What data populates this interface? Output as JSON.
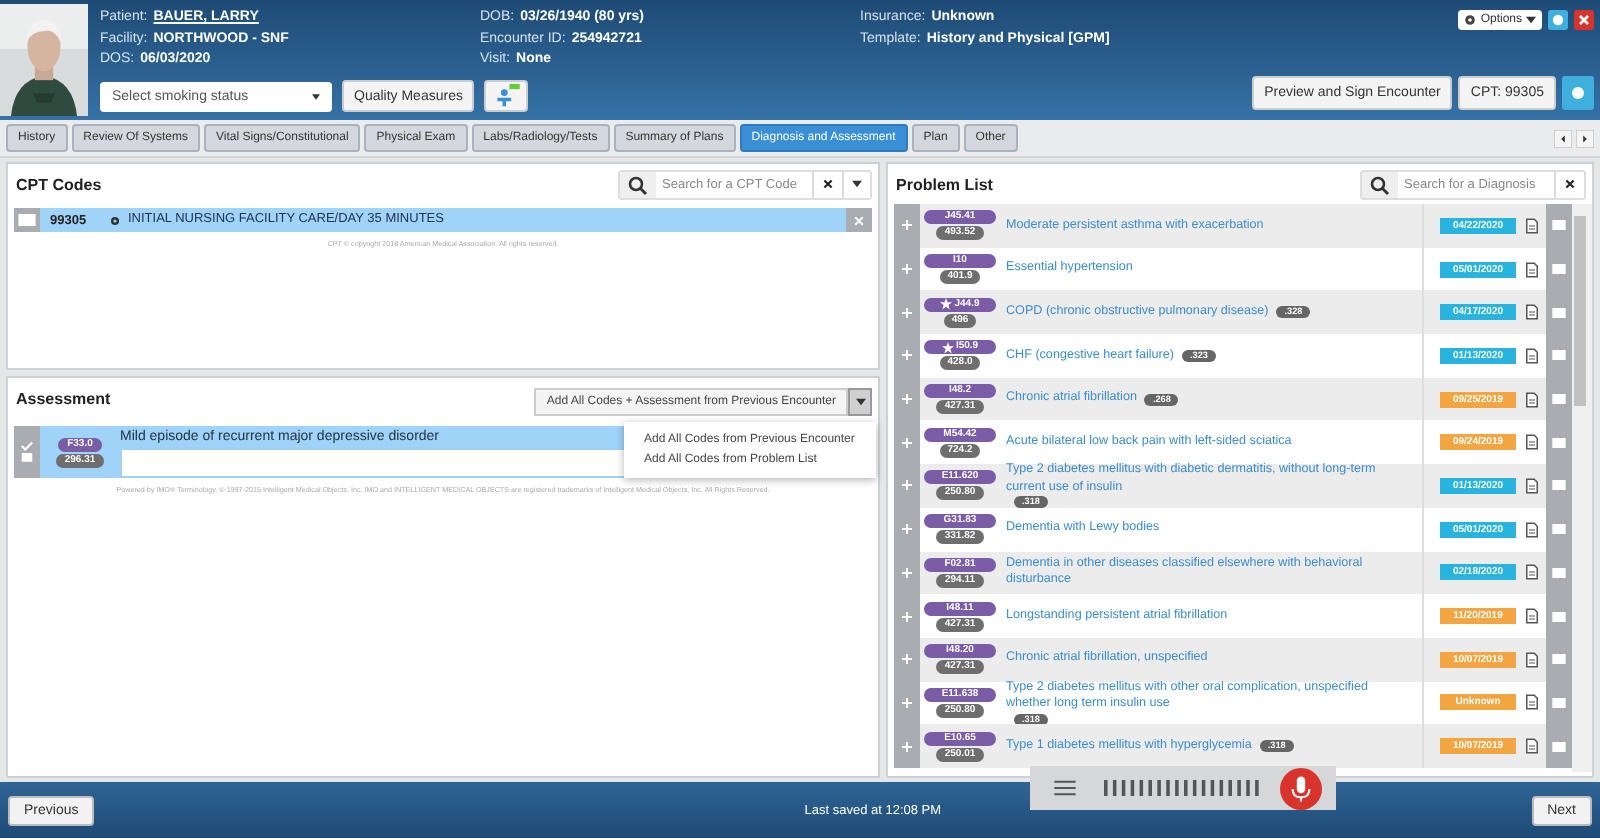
{
  "header": {
    "info_columns": [
      [
        {
          "label": "Patient:",
          "value": "BAUER, LARRY",
          "link": true
        },
        {
          "label": "Facility:",
          "value": "NORTHWOOD - SNF",
          "link": false
        },
        {
          "label": "DOS:",
          "value": "06/03/2020",
          "link": false
        }
      ],
      [
        {
          "label": "DOB:",
          "value": "03/26/1940 (80 yrs)",
          "link": false
        },
        {
          "label": "Encounter ID:",
          "value": "254942721",
          "link": false
        },
        {
          "label": "Visit:",
          "value": "None",
          "link": false
        }
      ],
      [
        {
          "label": "Insurance:",
          "value": "Unknown",
          "link": false
        },
        {
          "label": "Template:",
          "value": "History and Physical [GPM]",
          "link": false
        }
      ]
    ],
    "smoking_select": {
      "placeholder": "Select smoking status"
    },
    "quality_button": "Quality Measures",
    "options_button": "Options",
    "preview_button": "Preview and Sign Encounter",
    "cpt_button": "CPT: 99305"
  },
  "tabs": [
    {
      "label": "History",
      "selected": false
    },
    {
      "label": "Review Of Systems",
      "selected": false
    },
    {
      "label": "Vital Signs/Constitutional",
      "selected": false
    },
    {
      "label": "Physical Exam",
      "selected": false
    },
    {
      "label": "Labs/Radiology/Tests",
      "selected": false
    },
    {
      "label": "Summary of Plans",
      "selected": false
    },
    {
      "label": "Diagnosis and Assessment",
      "selected": true
    },
    {
      "label": "Plan",
      "selected": false
    },
    {
      "label": "Other",
      "selected": false
    }
  ],
  "cpt": {
    "title": "CPT Codes",
    "search": {
      "placeholder": "Search for a CPT Code"
    },
    "rows": [
      {
        "code": "99305",
        "description": "INITIAL NURSING FACILITY CARE/DAY 35 MINUTES",
        "selected": true
      }
    ],
    "copyright": "CPT © copyright 2018 American Medical Association. All rights reserved."
  },
  "assessment": {
    "title": "Assessment",
    "add_button": "Add All Codes + Assessment from Previous Encounter",
    "menu": {
      "expanded": true,
      "items": [
        "Add All Codes from Previous Encounter",
        "Add All Codes from Problem List"
      ]
    },
    "rows": [
      {
        "icd10": "F33.0",
        "icd9": "296.31",
        "description": "Mild episode of recurrent major depressive disorder",
        "checked": true
      }
    ],
    "notice": "Powered by IMO® Terminology. © 1997-2015 Intelligent Medical Objects, Inc. IMO and INTELLIGENT MEDICAL OBJECTS are registered trademarks of Intelligent Medical Objects, Inc. All Rights Reserved."
  },
  "problem_list": {
    "title": "Problem List",
    "search": {
      "placeholder": "Search for a Diagnosis"
    },
    "items": [
      {
        "icd10": "J45.41",
        "icd9": "493.52",
        "starred": false,
        "description": "Moderate persistent asthma with exacerbation",
        "date": "04/22/2020",
        "color": "#29b3df"
      },
      {
        "icd10": "I10",
        "icd9": "401.9",
        "starred": false,
        "description": "Essential hypertension",
        "date": "05/01/2020",
        "color": "#29b3df"
      },
      {
        "icd10": "J44.9",
        "icd9": "496",
        "starred": true,
        "description": "COPD (chronic obstructive pulmonary disease)",
        "score": ".328",
        "date": "04/17/2020",
        "color": "#29b3df"
      },
      {
        "icd10": "I50.9",
        "icd9": "428.0",
        "starred": true,
        "description": "CHF (congestive heart failure)",
        "score": ".323",
        "date": "01/13/2020",
        "color": "#29b3df"
      },
      {
        "icd10": "I48.2",
        "icd9": "427.31",
        "starred": false,
        "description": "Chronic atrial fibrillation",
        "score": ".268",
        "date": "09/25/2019",
        "color": "#f2a541"
      },
      {
        "icd10": "M54.42",
        "icd9": "724.2",
        "starred": false,
        "description": "Acute bilateral low back pain with left-sided sciatica",
        "date": "09/24/2019",
        "color": "#f2a541"
      },
      {
        "icd10": "E11.620",
        "icd9": "250.80",
        "starred": false,
        "description": "Type 2 diabetes mellitus with diabetic dermatitis, without long-term current use of insulin",
        "score": ".318",
        "date": "01/13/2020",
        "color": "#29b3df"
      },
      {
        "icd10": "G31.83",
        "icd9": "331.82",
        "starred": false,
        "description": "Dementia with Lewy bodies",
        "date": "05/01/2020",
        "color": "#29b3df"
      },
      {
        "icd10": "F02.81",
        "icd9": "294.11",
        "starred": false,
        "description": "Dementia in other diseases classified elsewhere with behavioral disturbance",
        "date": "02/18/2020",
        "color": "#29b3df"
      },
      {
        "icd10": "I48.11",
        "icd9": "427.31",
        "starred": false,
        "description": "Longstanding persistent atrial fibrillation",
        "date": "11/20/2019",
        "color": "#f2a541"
      },
      {
        "icd10": "I48.20",
        "icd9": "427.31",
        "starred": false,
        "description": "Chronic atrial fibrillation, unspecified",
        "date": "10/07/2019",
        "color": "#f2a541"
      },
      {
        "icd10": "E11.638",
        "icd9": "250.80",
        "starred": false,
        "description": "Type 2 diabetes mellitus with other oral complication, unspecified whether long term insulin use",
        "score": ".318",
        "date": "Unknown",
        "color": "#f2a541"
      },
      {
        "icd10": "E10.65",
        "icd9": "250.01",
        "starred": false,
        "description": "Type 1 diabetes mellitus with hyperglycemia",
        "score": ".318",
        "date": "10/07/2019",
        "color": "#f2a541"
      }
    ]
  },
  "footer": {
    "previous_button": "Previous",
    "status": "Last saved at 12:08 PM",
    "next_button": "Next"
  }
}
